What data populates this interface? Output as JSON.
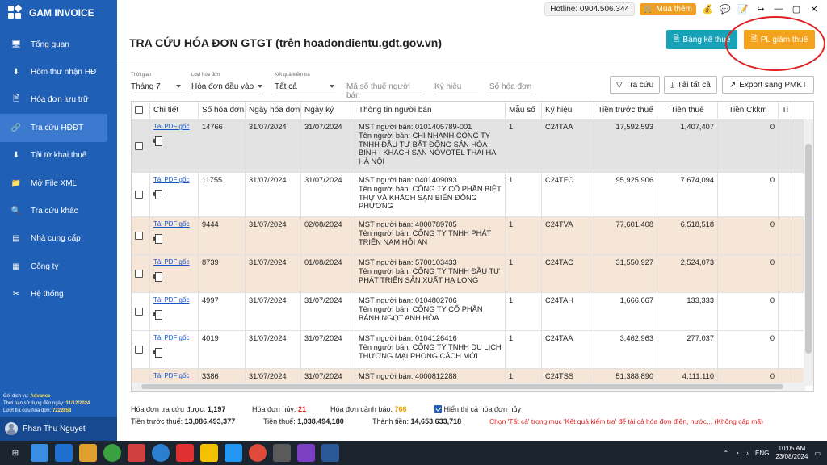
{
  "app": {
    "name": "GAM INVOICE"
  },
  "sidebar": {
    "items": [
      {
        "label": "Tổng quan",
        "icon": "monitor-icon"
      },
      {
        "label": "Hòm thư nhận HĐ",
        "icon": "inbox-icon"
      },
      {
        "label": "Hóa đơn lưu trữ",
        "icon": "document-icon"
      },
      {
        "label": "Tra cứu HĐĐT",
        "icon": "link-icon"
      },
      {
        "label": "Tải tờ khai thuế",
        "icon": "download-doc-icon"
      },
      {
        "label": "Mở File XML",
        "icon": "folder-icon"
      },
      {
        "label": "Tra cứu khác",
        "icon": "search-icon"
      },
      {
        "label": "Nhà cung cấp",
        "icon": "contact-card-icon"
      },
      {
        "label": "Công ty",
        "icon": "building-icon"
      },
      {
        "label": "Hệ thống",
        "icon": "tools-icon"
      }
    ],
    "footer": {
      "plan_label": "Gói dịch vụ:",
      "plan_value": "Advance",
      "expiry_label": "Thời hạn sử dụng đến ngày:",
      "expiry_value": "31/12/2024",
      "lookups_label": "Lượt tra cứu hóa đơn:",
      "lookups_value": "7222858"
    },
    "user": "Phan Thu Nguyet"
  },
  "topbar": {
    "hotline": "Hotline: 0904.506.344",
    "buy": "Mua thêm"
  },
  "header": {
    "title": "TRA CỨU HÓA ĐƠN GTGT (trên hoadondientu.gdt.gov.vn)",
    "tax_button": "Bảng kê thuế",
    "pl_button": "PL giảm thuế"
  },
  "filters": {
    "period": {
      "caption": "Thời gian",
      "value": "Tháng 7"
    },
    "type": {
      "caption": "Loại hóa đơn",
      "value": "Hóa đơn đầu vào"
    },
    "result": {
      "caption": "Kết quả kiểm tra",
      "value": "Tất cả"
    },
    "mst_placeholder": "Mã số thuế người bán",
    "symbol_placeholder": "Ký hiệu",
    "number_placeholder": "Số hóa đơn",
    "search_button": "Tra cứu",
    "download_all_button": "Tải tất cả",
    "export_button": "Export sang PMKT"
  },
  "table": {
    "headers": [
      "Chi tiết",
      "Số hóa đơn",
      "Ngày hóa đơn",
      "Ngày ký",
      "Thông tin người bán",
      "Mẫu số",
      "Ký hiệu",
      "Tiền trước thuế",
      "Tiền thuế",
      "Tiền Ckkm",
      "Ti"
    ],
    "pdf_label": "Tải PDF gốc",
    "rows": [
      {
        "no": "14766",
        "date": "31/07/2024",
        "signed": "31/07/2024",
        "seller": [
          "MST người bán: 0101405789-001",
          "Tên người bán: CHI NHÁNH CÔNG TY",
          "TNHH ĐẦU TƯ BẤT ĐỘNG SẢN HÒA",
          "BÌNH - KHÁCH SẠN NOVOTEL THÁI HÀ",
          "HÀ NỘI"
        ],
        "form": "1",
        "symbol": "C24TAA",
        "pre": "17,592,593",
        "tax": "1,407,407",
        "ck": "0",
        "bg": "#e3e3e3"
      },
      {
        "no": "11755",
        "date": "31/07/2024",
        "signed": "31/07/2024",
        "seller": [
          "MST người bán: 0401409093",
          "Tên người bán: CÔNG TY CỔ PHẦN BIỆT",
          "THỰ VÀ KHÁCH SẠN BIỂN ĐÔNG",
          "PHƯƠNG"
        ],
        "form": "1",
        "symbol": "C24TFO",
        "pre": "95,925,906",
        "tax": "7,674,094",
        "ck": "0",
        "bg": "#ffffff"
      },
      {
        "no": "9444",
        "date": "31/07/2024",
        "signed": "02/08/2024",
        "seller": [
          "MST người bán: 4000789705",
          "Tên người bán: CÔNG TY TNHH PHÁT",
          "TRIỂN NAM HỘI AN"
        ],
        "form": "1",
        "symbol": "C24TVA",
        "pre": "77,601,408",
        "tax": "6,518,518",
        "ck": "0",
        "bg": "#f5e6d8"
      },
      {
        "no": "8739",
        "date": "31/07/2024",
        "signed": "01/08/2024",
        "seller": [
          "MST người bán: 5700103433",
          "Tên người bán: CÔNG TY TNHH ĐẦU TƯ",
          "PHÁT TRIỂN SẢN XUẤT HẠ LONG"
        ],
        "form": "1",
        "symbol": "C24TAC",
        "pre": "31,550,927",
        "tax": "2,524,073",
        "ck": "0",
        "bg": "#f5e6d8"
      },
      {
        "no": "4997",
        "date": "31/07/2024",
        "signed": "31/07/2024",
        "seller": [
          "MST người bán: 0104802706",
          "Tên người bán: CÔNG TY CỔ PHẦN",
          "BÁNH NGỌT ANH HÒA"
        ],
        "form": "1",
        "symbol": "C24TAH",
        "pre": "1,666,667",
        "tax": "133,333",
        "ck": "0",
        "bg": "#ffffff"
      },
      {
        "no": "4019",
        "date": "31/07/2024",
        "signed": "31/07/2024",
        "seller": [
          "MST người bán: 0104126416",
          "Tên người bán: CÔNG TY TNHH DU LỊCH",
          "THƯƠNG MẠI PHONG CÁCH MỚI"
        ],
        "form": "1",
        "symbol": "C24TAA",
        "pre": "3,462,963",
        "tax": "277,037",
        "ck": "0",
        "bg": "#ffffff"
      },
      {
        "no": "3386",
        "date": "31/07/2024",
        "signed": "31/07/2024",
        "seller": [
          "MST người bán: 4000812288"
        ],
        "form": "1",
        "symbol": "C24TSS",
        "pre": "51,388,890",
        "tax": "4,111,110",
        "ck": "0",
        "bg": "#f5e6d8"
      }
    ]
  },
  "summary": {
    "count_label": "Hóa đơn tra cứu được:",
    "count": "1,197",
    "cancel_label": "Hóa đơn hủy:",
    "cancel": "21",
    "warn_label": "Hóa đơn cảnh báo:",
    "warn": "766",
    "show_cancel": "Hiển thị cả hóa đơn hủy",
    "pre_label": "Tiền trước thuế:",
    "pre": "13,086,493,377",
    "tax_label": "Tiền thuế:",
    "tax": "1,038,494,180",
    "total_label": "Thành tiền:",
    "total": "14,653,633,718",
    "note": "Chọn 'Tất cả' trong mục 'Kết quả kiểm tra' để tải cả hóa đơn điện, nước,.. (Không cấp mã)"
  },
  "taskbar": {
    "lang": "ENG",
    "time": "10:05 AM",
    "date": "23/08/2024"
  }
}
